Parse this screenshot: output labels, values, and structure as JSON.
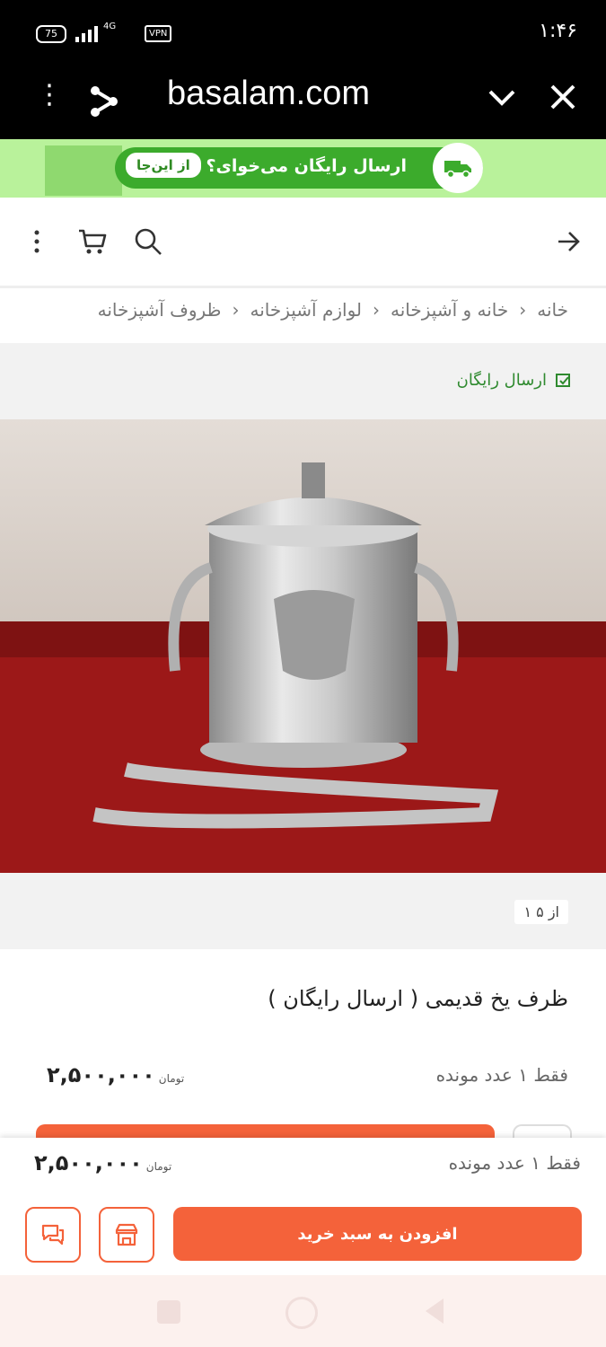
{
  "status_bar": {
    "time": "۱:۴۶",
    "battery": "75",
    "network": "4G",
    "vpn": "VPN"
  },
  "browser": {
    "url": "basalam.com"
  },
  "promo": {
    "text": "ارسال رایگان می‌خوای؟",
    "button": "از این‌جا"
  },
  "breadcrumb": {
    "items": [
      "خانه",
      "خانه و آشپزخانه",
      "لوازم آشپزخانه",
      "ظروف آشپزخانه"
    ]
  },
  "gallery": {
    "free_shipping": "ارسال رایگان",
    "counter": "۱ از ۵"
  },
  "product": {
    "title": "ظرف یخ قدیمی ( ارسال رایگان )",
    "stock": "فقط ۱ عدد مونده",
    "price": "۲,۵۰۰,۰۰۰",
    "currency": "تومان"
  },
  "bottom_bar": {
    "stock": "فقط ۱ عدد مونده",
    "price": "۲,۵۰۰,۰۰۰",
    "currency": "تومان",
    "add_to_cart": "افزودن به سبد خرید"
  },
  "colors": {
    "accent": "#f4623a",
    "promo_green": "#3cab2c",
    "shipping_green": "#2f8a2f"
  }
}
